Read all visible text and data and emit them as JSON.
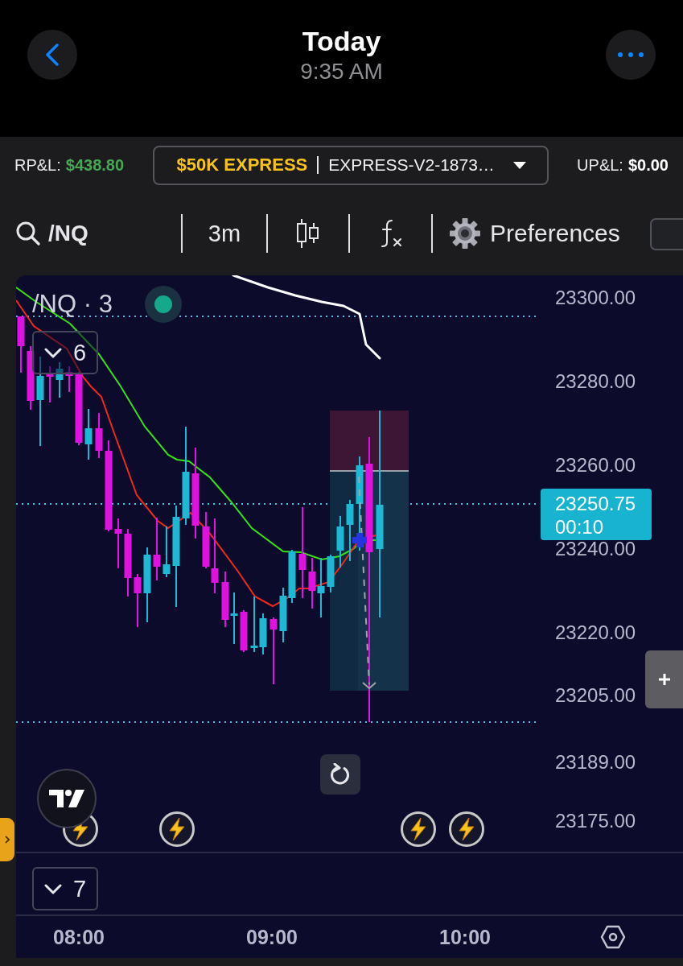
{
  "header": {
    "title": "Today",
    "time": "9:35 AM"
  },
  "account_bar": {
    "realized_label": "RP&L:",
    "realized_value": "$438.80",
    "account_name": "$50K EXPRESS",
    "account_id": "EXPRESS-V2-1873…",
    "unrealized_label": "UP&L:",
    "unrealized_value": "$0.00"
  },
  "toolbar": {
    "symbol": "/NQ",
    "interval": "3m",
    "preferences": "Preferences",
    "toggle": {
      "checked": false
    }
  },
  "chart": {
    "legend": "/NQ · 3",
    "indicators_count": "6",
    "price_labels": [
      "23300.00",
      "23280.00",
      "23260.00",
      "23240.00",
      "23220.00",
      "23205.00",
      "23189.00",
      "23175.00"
    ],
    "last_price": {
      "price": "23250.75",
      "countdown": "00:10"
    }
  },
  "volume_pane": {
    "indicators_count": "7"
  },
  "time_axis": {
    "labels": [
      "08:00",
      "09:00",
      "10:00"
    ]
  }
}
